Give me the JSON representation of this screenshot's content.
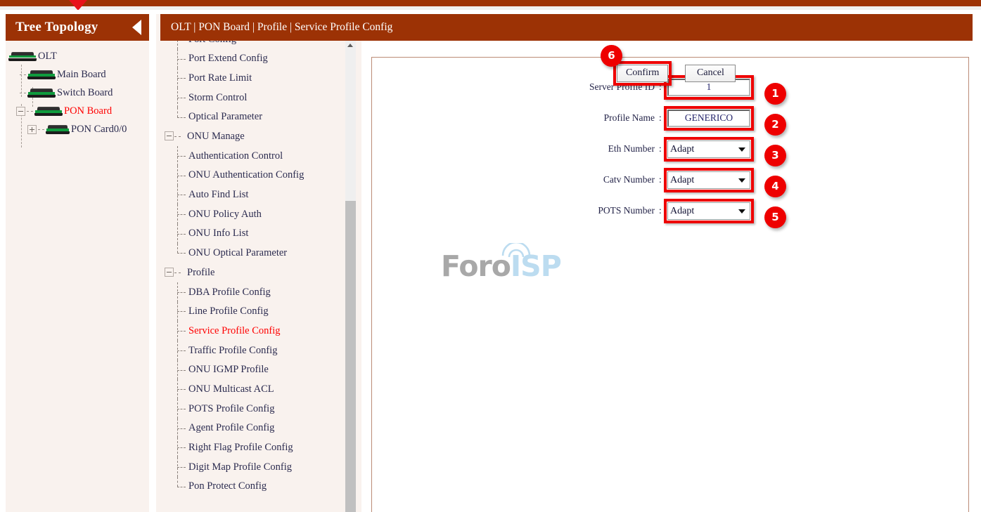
{
  "header": {
    "breadcrumb": "OLT | PON Board | Profile | Service Profile Config"
  },
  "sidebar": {
    "title": "Tree Topology",
    "collapse_icon": "triangle-left-icon",
    "tree": [
      {
        "label": "OLT",
        "level": 0,
        "icon": "device-icon",
        "red": false,
        "expander": "none"
      },
      {
        "label": "Main Board",
        "level": 1,
        "icon": "device-icon",
        "red": false,
        "expander": "none"
      },
      {
        "label": "Switch Board",
        "level": 1,
        "icon": "device-icon",
        "red": false,
        "expander": "none"
      },
      {
        "label": "PON Board",
        "level": 1,
        "icon": "device-icon",
        "red": true,
        "expander": "minus"
      },
      {
        "label": "PON Card0/0",
        "level": 2,
        "icon": "device-icon",
        "red": false,
        "expander": "plus"
      }
    ]
  },
  "menu": {
    "items": [
      {
        "label": "Port Config",
        "type": "leaf",
        "active": false,
        "clipped": true
      },
      {
        "label": "Port Extend Config",
        "type": "leaf",
        "active": false
      },
      {
        "label": "Port Rate Limit",
        "type": "leaf",
        "active": false
      },
      {
        "label": "Storm Control",
        "type": "leaf",
        "active": false
      },
      {
        "label": "Optical Parameter",
        "type": "leaf",
        "active": false,
        "last": true
      },
      {
        "label": "ONU Manage",
        "type": "group",
        "active": false
      },
      {
        "label": "Authentication Control",
        "type": "leaf",
        "active": false
      },
      {
        "label": "ONU Authentication Config",
        "type": "leaf",
        "active": false
      },
      {
        "label": "Auto Find List",
        "type": "leaf",
        "active": false
      },
      {
        "label": "ONU Policy Auth",
        "type": "leaf",
        "active": false
      },
      {
        "label": "ONU Info List",
        "type": "leaf",
        "active": false
      },
      {
        "label": "ONU Optical Parameter",
        "type": "leaf",
        "active": false,
        "last": true
      },
      {
        "label": "Profile",
        "type": "group",
        "active": false
      },
      {
        "label": "DBA Profile Config",
        "type": "leaf",
        "active": false
      },
      {
        "label": "Line Profile Config",
        "type": "leaf",
        "active": false
      },
      {
        "label": "Service Profile Config",
        "type": "leaf",
        "active": true
      },
      {
        "label": "Traffic Profile Config",
        "type": "leaf",
        "active": false
      },
      {
        "label": "ONU IGMP Profile",
        "type": "leaf",
        "active": false
      },
      {
        "label": "ONU Multicast ACL",
        "type": "leaf",
        "active": false
      },
      {
        "label": "POTS Profile Config",
        "type": "leaf",
        "active": false
      },
      {
        "label": "Agent Profile Config",
        "type": "leaf",
        "active": false
      },
      {
        "label": "Right Flag Profile Config",
        "type": "leaf",
        "active": false
      },
      {
        "label": "Digit Map Profile Config",
        "type": "leaf",
        "active": false
      },
      {
        "label": "Pon Protect Config",
        "type": "leaf",
        "active": false,
        "last": true
      }
    ]
  },
  "form": {
    "fields": [
      {
        "label": "Server Profile ID",
        "colon": ":",
        "type": "text",
        "value": "1",
        "badge": "1"
      },
      {
        "label": "Profile Name",
        "colon": ":",
        "type": "text",
        "value": "GENERICO",
        "badge": "2"
      },
      {
        "label": "Eth Number",
        "colon": ":",
        "type": "select",
        "value": "Adapt",
        "badge": "3",
        "options": [
          "Adapt"
        ]
      },
      {
        "label": "Catv Number",
        "colon": ":",
        "type": "select",
        "value": "Adapt",
        "badge": "4",
        "options": [
          "Adapt"
        ]
      },
      {
        "label": "POTS Number",
        "colon": ":",
        "type": "select",
        "value": "Adapt",
        "badge": "5",
        "options": [
          "Adapt"
        ]
      }
    ],
    "confirm_label": "Confirm",
    "cancel_label": "Cancel",
    "confirm_badge": "6"
  },
  "watermark": {
    "part1": "Foro",
    "part2": "ISP"
  },
  "colors": {
    "brand_brown": "#9c3205",
    "annotation_red": "#ee0000",
    "active_red": "#ff0000",
    "sidebar_bg": "#f9f2ee",
    "panel_border": "#bb8b76"
  }
}
